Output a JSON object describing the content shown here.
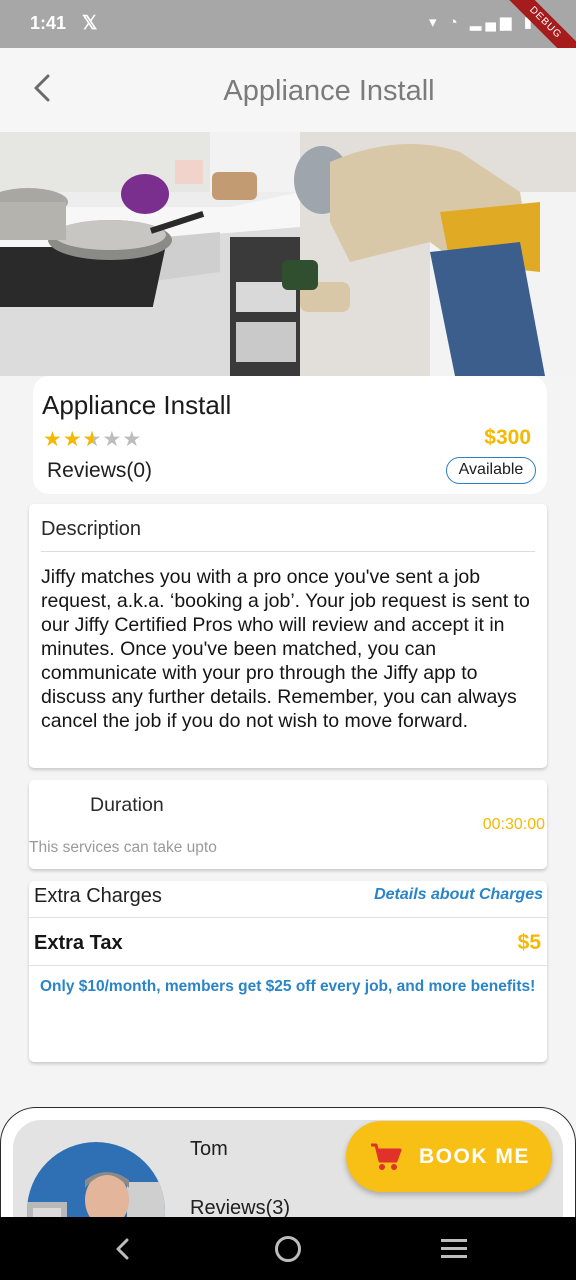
{
  "status_bar": {
    "time": "1:41",
    "app_glyph": "𝕏",
    "icons": "▾ ◔ ▂▄▆ ▮",
    "debug_label": "DEBUG"
  },
  "header": {
    "title": "Appliance Install",
    "back_icon": "chevron-left-icon"
  },
  "hero": {
    "description_icon": "hero-image"
  },
  "service": {
    "title": "Appliance Install",
    "rating": 2.5,
    "rating_max": 5,
    "price": "$300",
    "reviews_label": "Reviews(0)",
    "availability": "Available"
  },
  "description": {
    "heading": "Description",
    "body": "Jiffy matches you with a pro once you've sent a job request, a.k.a. ‘booking a job’. Your job request is sent to our Jiffy Certified Pros who will review and accept it in minutes. Once you've been matched, you can communicate with your pro through the Jiffy app to discuss any further details. Remember, you can always cancel the job if you do not wish to move forward."
  },
  "duration": {
    "heading": "Duration",
    "value": "00:30:00",
    "note": "This services can take upto"
  },
  "charges": {
    "heading": "Extra Charges",
    "details_link": "Details about Charges",
    "tax_label": "Extra Tax",
    "tax_value": "$5",
    "membership_note": "Only $10/month, members get $25 off every job, and more benefits!"
  },
  "pro": {
    "name": "Tom",
    "reviews_label": "Reviews(3)"
  },
  "book_button": {
    "label": "BOOK ME",
    "icon": "cart-icon"
  },
  "colors": {
    "accent": "#f6b800",
    "link": "#2a84c8",
    "button": "#f8bf14"
  }
}
